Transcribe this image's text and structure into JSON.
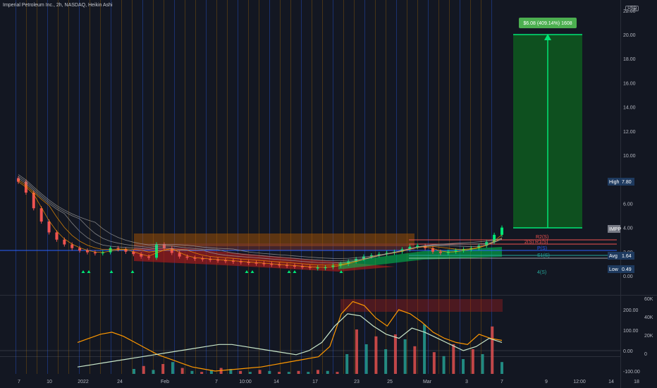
{
  "header": {
    "title": "Imperial Petroleum Inc., 2h, NASDAQ, Heikin Ashi",
    "currency": "USD"
  },
  "price_axis": {
    "ticks": [
      "22.00",
      "20.00",
      "18.00",
      "16.00",
      "14.00",
      "12.00",
      "10.00",
      "8.00",
      "6.00",
      "4.00",
      "2.00",
      "0.00"
    ]
  },
  "osc_axis": {
    "left_ticks": [
      "200.00",
      "100.00",
      "0.00",
      "-100.00"
    ],
    "right_ticks": [
      "60K",
      "40K",
      "20K",
      "0"
    ]
  },
  "time_axis": {
    "labels": [
      "7",
      "10",
      "2022",
      "24",
      "Feb",
      "7",
      "10:00",
      "14",
      "17",
      "23",
      "25",
      "Mar",
      "3",
      "7",
      "9",
      "12:00",
      "14",
      "18"
    ]
  },
  "labels": {
    "measure": "$6.08 (409.14%) 1608",
    "high_label": "High",
    "high_value": "7.80",
    "last_label": "IMPP",
    "avg_label": "Avg",
    "avg_value": "1.64",
    "low_label": "Low",
    "low_value": "0.49",
    "pivot_r2": "R2(S)",
    "pivot_r1": "2(S) R1(S)",
    "pivot_p": "P(S)",
    "pivot_s1": "S1(S)",
    "pivot_s4": "4(S)"
  },
  "colors": {
    "background": "#131722",
    "up": "#26a69a",
    "down": "#ef5350",
    "measure_fill": "#0e5a1e",
    "measure_line": "#00e676",
    "vline_orange": "#a86b00",
    "vline_blue": "#2962ff"
  },
  "chart_data": {
    "type": "candlestick",
    "ylim": [
      0,
      22
    ],
    "series": [
      {
        "name": "IMPP",
        "values": [
          7.8,
          6.9,
          5.6,
          4.5,
          3.6,
          3.0,
          2.6,
          2.3,
          2.1,
          1.95,
          1.9,
          1.95,
          2.3,
          2.2,
          2.0,
          1.8,
          1.6,
          1.5,
          2.6,
          2.3,
          1.9,
          1.6,
          1.5,
          1.45,
          1.4,
          1.35,
          1.3,
          1.25,
          1.2,
          1.15,
          1.1,
          1.05,
          1.0,
          0.95,
          0.9,
          0.85,
          0.8,
          0.75,
          0.7,
          0.7,
          0.72,
          0.85,
          1.0,
          1.2,
          1.4,
          1.6,
          1.7,
          1.8,
          1.9,
          2.0,
          2.2,
          2.4,
          2.5,
          2.3,
          2.0,
          1.9,
          2.0,
          2.1,
          2.2,
          2.3,
          2.5,
          2.8,
          3.4,
          4.0
        ]
      }
    ],
    "oscillator": {
      "ylim": [
        -150,
        260
      ],
      "lines": [
        {
          "name": "",
          "values": [
            40,
            60,
            80,
            90,
            70,
            40,
            10,
            -20,
            -40,
            -60,
            -80,
            -90,
            -100,
            -95,
            -90,
            -85,
            -80,
            -70,
            -60,
            -50,
            -40,
            -30,
            20,
            180,
            240,
            220,
            160,
            120,
            200,
            180,
            140,
            90,
            60,
            40,
            30,
            80,
            60,
            50
          ]
        },
        {
          "name": "",
          "values": [
            -80,
            -70,
            -60,
            -50,
            -40,
            -30,
            -20,
            -10,
            0,
            10,
            20,
            30,
            30,
            20,
            10,
            0,
            -10,
            -20,
            0,
            40,
            120,
            180,
            170,
            120,
            80,
            60,
            110,
            90,
            60,
            30,
            0,
            20,
            60,
            40
          ]
        }
      ],
      "volume": [
        5,
        8,
        4,
        10,
        12,
        6,
        3,
        2,
        4,
        6,
        5,
        3,
        2,
        4,
        3,
        2,
        2,
        3,
        2,
        4,
        3,
        2,
        20,
        45,
        30,
        38,
        25,
        40,
        35,
        28,
        50,
        22,
        18,
        30,
        15,
        25,
        20,
        48,
        12
      ]
    }
  }
}
